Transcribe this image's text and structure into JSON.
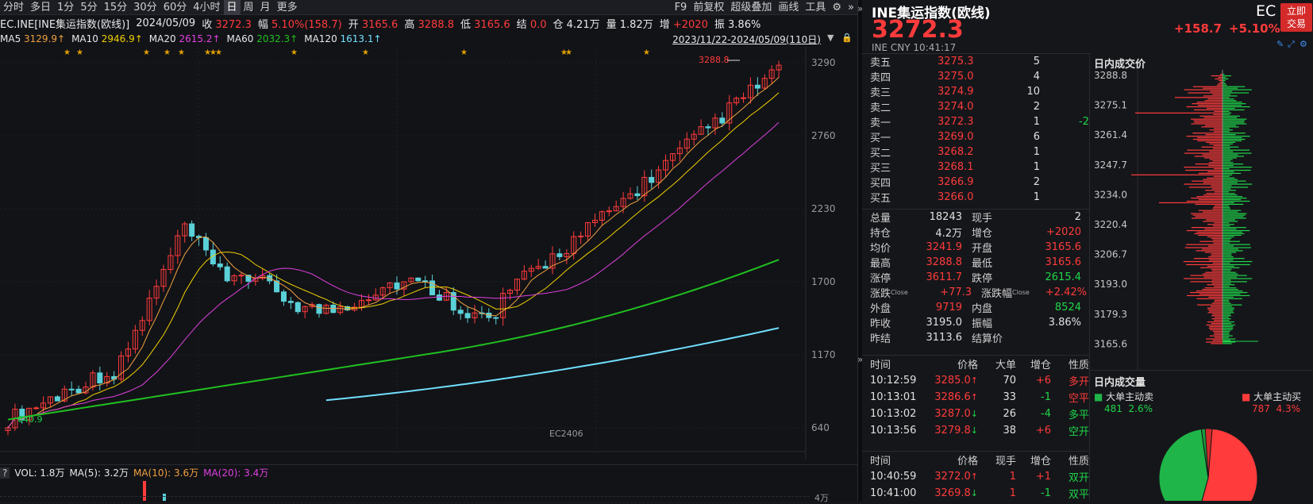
{
  "toolbar": {
    "periods": [
      "分时",
      "多日",
      "1分",
      "5分",
      "15分",
      "30分",
      "60分",
      "4小时",
      "日",
      "周",
      "月",
      "更多"
    ],
    "active": "日",
    "right_items": [
      "F9",
      "前复权",
      "超级叠加",
      "画线",
      "工具"
    ]
  },
  "info": {
    "symbol": "EC.INE[INE集运指数(欧线)]",
    "date": "2024/05/09",
    "close_label": "收",
    "close": "3272.3",
    "change_label": "幅",
    "change": "5.10%(158.7)",
    "open_label": "开",
    "open": "3165.6",
    "high_label": "高",
    "high": "3288.8",
    "low_label": "低",
    "low": "3165.6",
    "settle_label": "结",
    "settle": "0.0",
    "oi_label": "仓",
    "oi": "4.21万",
    "vol_label": "量",
    "vol": "1.82万",
    "inc_label": "增",
    "inc": "+2020",
    "amp_label": "振",
    "amp": "3.86%"
  },
  "ma": {
    "ma5_label": "MA5",
    "ma5": "3129.9↑",
    "ma10_label": "MA10",
    "ma10": "2946.9↑",
    "ma20_label": "MA20",
    "ma20": "2615.2↑",
    "ma60_label": "MA60",
    "ma60": "2032.3↑",
    "ma120_label": "MA120",
    "ma120": "1613.1↑",
    "range": "2023/11/22-2024/05/09(110日)"
  },
  "chart_axis": {
    "y_ticks": [
      "3290",
      "2760",
      "2230",
      "1700",
      "1170",
      "640"
    ],
    "high_marker": "3288.8",
    "low_marker": "640.9",
    "contract": "EC2406"
  },
  "volbar": {
    "q": "?",
    "vol": "VOL: 1.8万",
    "ma5": "MA(5): 3.2万",
    "ma10": "MA(10): 3.6万",
    "ma20": "MA(20): 3.4万",
    "tick": "4万"
  },
  "colors": {
    "up": "#ff3b3b",
    "down": "#1fd64a",
    "ma5": "#ffffff",
    "ma10": "#f0d000",
    "ma20": "#e040e0",
    "ma60": "#20c020",
    "ma120": "#70e0ff",
    "accent": "#d42a2a"
  },
  "quote": {
    "name": "INE集运指数(欧线)",
    "price": "3272.3",
    "code": "EC",
    "change": "+158.7",
    "pct": "+5.10%",
    "sub": "INE  CNY  10:41:17",
    "trade_btn": "立即交易"
  },
  "orderbook": [
    {
      "label": "卖五",
      "price": "3275.3",
      "vol": "5",
      "chg": ""
    },
    {
      "label": "卖四",
      "price": "3275.0",
      "vol": "4",
      "chg": ""
    },
    {
      "label": "卖三",
      "price": "3274.9",
      "vol": "10",
      "chg": ""
    },
    {
      "label": "卖二",
      "price": "3274.0",
      "vol": "2",
      "chg": ""
    },
    {
      "label": "卖一",
      "price": "3272.3",
      "vol": "1",
      "chg": "-2"
    },
    {
      "label": "买一",
      "price": "3269.0",
      "vol": "6",
      "chg": ""
    },
    {
      "label": "买二",
      "price": "3268.2",
      "vol": "1",
      "chg": ""
    },
    {
      "label": "买三",
      "price": "3268.1",
      "vol": "1",
      "chg": ""
    },
    {
      "label": "买四",
      "price": "3266.9",
      "vol": "2",
      "chg": ""
    },
    {
      "label": "买五",
      "price": "3266.0",
      "vol": "1",
      "chg": ""
    }
  ],
  "stats": [
    {
      "l1": "总量",
      "v1": "18243",
      "l2": "现手",
      "v2": "2"
    },
    {
      "l1": "持仓",
      "v1": "4.2万",
      "l2": "增仓",
      "v2": "+2020"
    },
    {
      "l1": "均价",
      "v1": "3241.9",
      "l2": "开盘",
      "v2": "3165.6"
    },
    {
      "l1": "最高",
      "v1": "3288.8",
      "l2": "最低",
      "v2": "3165.6"
    },
    {
      "l1": "涨停",
      "v1": "3611.7",
      "l2": "跌停",
      "v2": "2615.4"
    },
    {
      "l1": "涨跌",
      "v1": "+77.3",
      "l2": "涨跌幅",
      "v2": "+2.42%"
    },
    {
      "l1": "外盘",
      "v1": "9719",
      "l2": "内盘",
      "v2": "8524"
    },
    {
      "l1": "昨收",
      "v1": "3195.0",
      "l2": "振幅",
      "v2": "3.86%"
    },
    {
      "l1": "昨结",
      "v1": "3113.6",
      "l2": "结算价",
      "v2": ""
    }
  ],
  "stats_sup": "Close",
  "big_trades": {
    "headers": [
      "时间",
      "价格",
      "大单",
      "增仓",
      "性质"
    ],
    "rows": [
      {
        "time": "10:12:59",
        "price": "3285.0",
        "arrow": "↑",
        "vol": "70",
        "inc": "+6",
        "type": "多开"
      },
      {
        "time": "10:13:01",
        "price": "3286.6",
        "arrow": "↑",
        "vol": "33",
        "inc": "-1",
        "type": "空平"
      },
      {
        "time": "10:13:02",
        "price": "3287.0",
        "arrow": "↓",
        "vol": "26",
        "inc": "-4",
        "type": "多平"
      },
      {
        "time": "10:13:56",
        "price": "3279.8",
        "arrow": "↓",
        "vol": "38",
        "inc": "+6",
        "type": "空开"
      }
    ]
  },
  "ticks": {
    "headers": [
      "时间",
      "价格",
      "现手",
      "增仓",
      "性质"
    ],
    "rows": [
      {
        "time": "10:40:59",
        "price": "3272.0",
        "arrow": "↑",
        "vol": "1",
        "inc": "+1",
        "type": "双开"
      },
      {
        "time": "10:41:00",
        "price": "3269.8",
        "arrow": "↓",
        "vol": "1",
        "inc": "-1",
        "type": "双平"
      }
    ]
  },
  "profile": {
    "title": "日内成交价",
    "ticks": [
      "3288.8",
      "3275.1",
      "3261.4",
      "3247.7",
      "3234.0",
      "3220.4",
      "3206.7",
      "3193.0",
      "3179.3",
      "3165.6"
    ]
  },
  "pie": {
    "title": "日内成交量",
    "sell_label": "大单主动卖",
    "sell_vol": "481",
    "sell_pct": "2.6%",
    "buy_label": "大单主动买",
    "buy_vol": "787",
    "buy_pct": "4.3%",
    "buy_fraction": 0.53
  }
}
